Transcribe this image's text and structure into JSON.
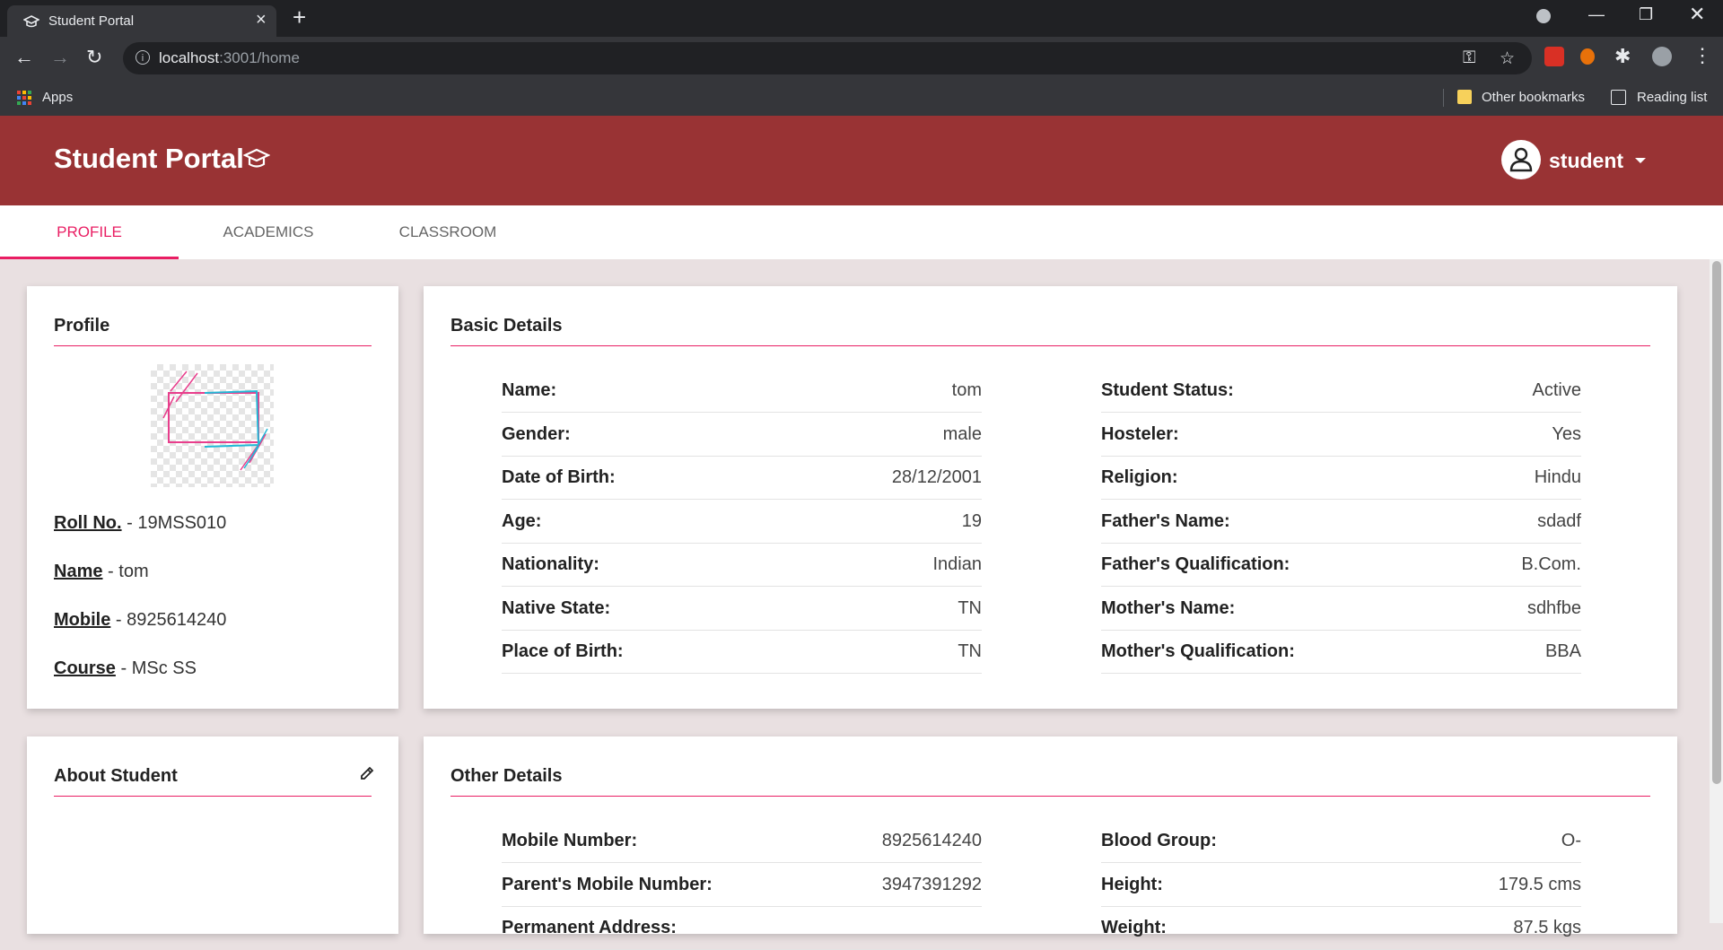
{
  "browser": {
    "tab_title": "Student Portal",
    "url_host": "localhost",
    "url_rest": ":3001/home",
    "bookmarks": {
      "apps": "Apps",
      "other": "Other bookmarks",
      "reading": "Reading list"
    }
  },
  "header": {
    "title": "Student Portal",
    "user": "student"
  },
  "tabs": [
    "PROFILE",
    "ACADEMICS",
    "CLASSROOM"
  ],
  "profile": {
    "title": "Profile",
    "fields": [
      {
        "label": "Roll No.",
        "value": "19MSS010"
      },
      {
        "label": "Name",
        "value": "tom"
      },
      {
        "label": "Mobile",
        "value": "8925614240"
      },
      {
        "label": "Course",
        "value": "MSc SS"
      }
    ],
    "separator": " - "
  },
  "basic": {
    "title": "Basic Details",
    "left": [
      {
        "label": "Name:",
        "value": "tom"
      },
      {
        "label": "Gender:",
        "value": "male"
      },
      {
        "label": "Date of Birth:",
        "value": "28/12/2001"
      },
      {
        "label": "Age:",
        "value": "19"
      },
      {
        "label": "Nationality:",
        "value": "Indian"
      },
      {
        "label": "Native State:",
        "value": "TN"
      },
      {
        "label": "Place of Birth:",
        "value": "TN"
      }
    ],
    "right": [
      {
        "label": "Student Status:",
        "value": "Active"
      },
      {
        "label": "Hosteler:",
        "value": "Yes"
      },
      {
        "label": "Religion:",
        "value": "Hindu"
      },
      {
        "label": "Father's Name:",
        "value": "sdadf"
      },
      {
        "label": "Father's Qualification:",
        "value": "B.Com."
      },
      {
        "label": "Mother's Name:",
        "value": "sdhfbe"
      },
      {
        "label": "Mother's Qualification:",
        "value": "BBA"
      }
    ]
  },
  "about": {
    "title": "About Student"
  },
  "other": {
    "title": "Other Details",
    "left": [
      {
        "label": "Mobile Number:",
        "value": "8925614240"
      },
      {
        "label": "Parent's Mobile Number:",
        "value": "3947391292"
      },
      {
        "label": "Permanent Address:",
        "value": ""
      }
    ],
    "right": [
      {
        "label": "Blood Group:",
        "value": "O-"
      },
      {
        "label": "Height:",
        "value": "179.5 cms"
      },
      {
        "label": "Weight:",
        "value": "87.5 kgs"
      }
    ]
  },
  "colors": {
    "header": "#993334",
    "accent": "#e91e63",
    "background": "#e9e0e1"
  }
}
